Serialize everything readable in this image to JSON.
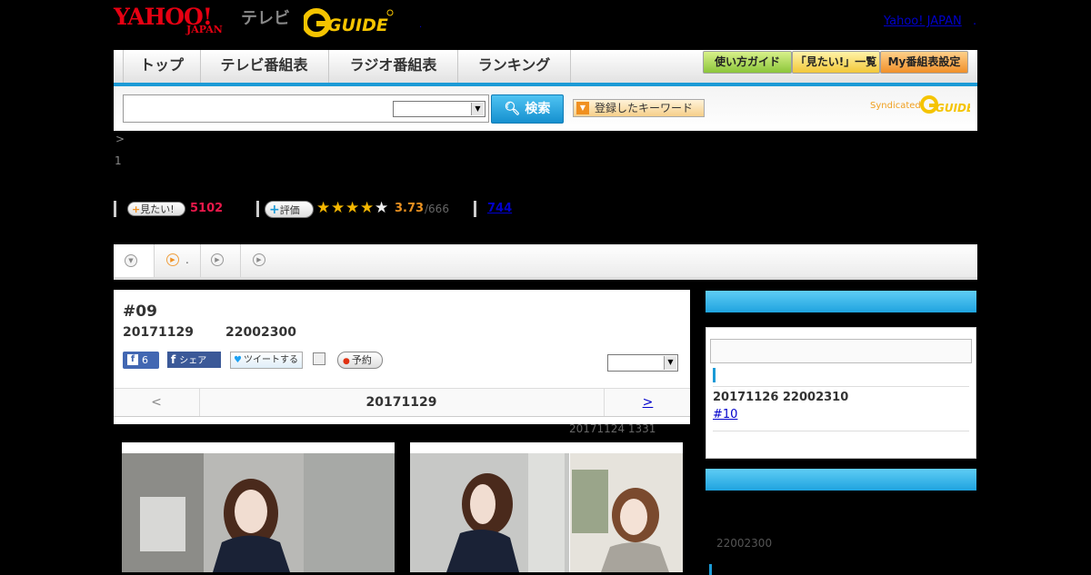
{
  "header": {
    "logo_yahoo": "YAHOO!",
    "logo_japan": "JAPAN",
    "logo_tv": "テレビ",
    "logo_gguide": "G-GUIDE",
    "yahoo_japan_link": "Yahoo! JAPAN",
    "dot": "."
  },
  "nav": {
    "tabs": [
      "トップ",
      "テレビ番組表",
      "ラジオ番組表",
      "ランキング"
    ],
    "buttons": [
      "使い方ガイド",
      "「見たい!」一覧",
      "My番組表設定"
    ]
  },
  "search": {
    "input_value": "",
    "select_value": "",
    "button_label": "検索",
    "keyword_button": "登録したキーワード",
    "syndicated": "Syndicated",
    "syndicated_logo": "G-GUIDE"
  },
  "breadcrumb": {
    "arrow": ">",
    "number": "1"
  },
  "stats": {
    "want_label": "見たい!",
    "want_count": "5102",
    "rate_label": "評価",
    "rating": 3.73,
    "rating_text": "3.73",
    "rating_count": "/666",
    "review_count": "744"
  },
  "tabs": {
    "tab2_text": "."
  },
  "episode": {
    "number": "#09",
    "date": "20171129",
    "time": "22002300",
    "like_count": "6",
    "share_label": "シェア",
    "tweet_label": "ツイートする",
    "reserve_label": "予約",
    "select_value": ""
  },
  "date_nav": {
    "prev": "<",
    "current": "20171129",
    "next": ">"
  },
  "updated": "20171124  1331",
  "sidebar": {
    "next_date": "20171126  22002310",
    "next_link": "#10",
    "box2_time": "22002300"
  },
  "colors": {
    "accent_blue": "#1b9ad6",
    "want_red": "#e8184a",
    "rating_orange": "#e89020"
  }
}
